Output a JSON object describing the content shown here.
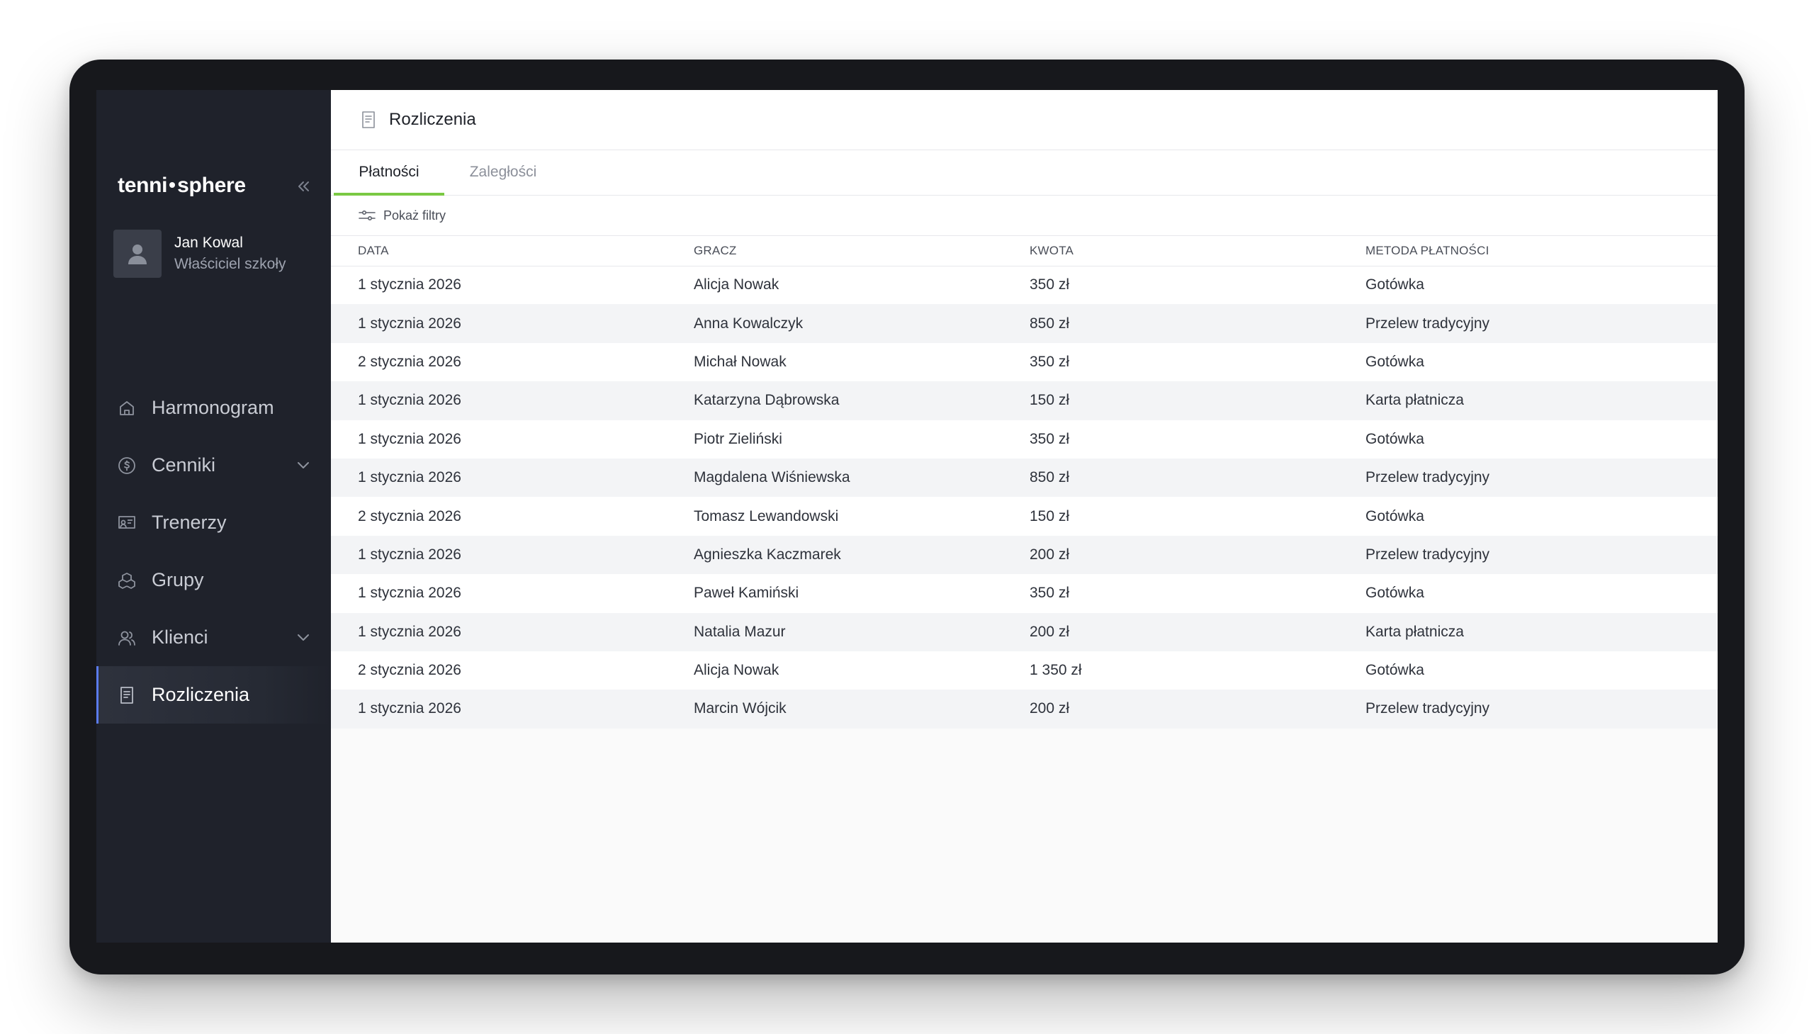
{
  "app": {
    "logo_left": "tenni",
    "logo_right": "sphere"
  },
  "user": {
    "name": "Jan Kowal",
    "role": "Właściciel szkoły"
  },
  "nav": {
    "items": [
      {
        "label": "Harmonogram",
        "icon": "home-icon"
      },
      {
        "label": "Cenniki",
        "icon": "dollar-circle-icon"
      },
      {
        "label": "Trenerzy",
        "icon": "trainer-board-icon"
      },
      {
        "label": "Grupy",
        "icon": "groups-icon"
      },
      {
        "label": "Klienci",
        "icon": "users-icon"
      },
      {
        "label": "Rozliczenia",
        "icon": "receipt-icon"
      }
    ]
  },
  "page": {
    "title": "Rozliczenia"
  },
  "tabs": {
    "payments": "Płatności",
    "arrears": "Zaległości"
  },
  "filters": {
    "label": "Pokaż filtry"
  },
  "table": {
    "headers": [
      "DATA",
      "GRACZ",
      "KWOTA",
      "METODA PŁATNOŚCI"
    ],
    "rows": [
      [
        "1 stycznia 2026",
        "Alicja Nowak",
        "350 zł",
        "Gotówka"
      ],
      [
        "1 stycznia 2026",
        "Anna Kowalczyk",
        "850 zł",
        "Przelew tradycyjny"
      ],
      [
        "2 stycznia 2026",
        "Michał Nowak",
        "350 zł",
        "Gotówka"
      ],
      [
        "1 stycznia 2026",
        "Katarzyna Dąbrowska",
        "150 zł",
        "Karta płatnicza"
      ],
      [
        "1 stycznia 2026",
        "Piotr Zieliński",
        "350 zł",
        "Gotówka"
      ],
      [
        "1 stycznia 2026",
        "Magdalena Wiśniewska",
        "850 zł",
        "Przelew tradycyjny"
      ],
      [
        "2 stycznia 2026",
        "Tomasz Lewandowski",
        "150 zł",
        "Gotówka"
      ],
      [
        "1 stycznia 2026",
        "Agnieszka Kaczmarek",
        "200 zł",
        "Przelew tradycyjny"
      ],
      [
        "1 stycznia 2026",
        "Paweł Kamiński",
        "350 zł",
        "Gotówka"
      ],
      [
        "1 stycznia 2026",
        "Natalia Mazur",
        "200 zł",
        "Karta płatnicza"
      ],
      [
        "2 stycznia 2026",
        "Alicja Nowak",
        "1 350 zł",
        "Gotówka"
      ],
      [
        "1 stycznia 2026",
        "Marcin Wójcik",
        "200 zł",
        "Przelew tradycyjny"
      ]
    ]
  },
  "colors": {
    "sidebar_bg": "#1f222b",
    "tab_accent": "#7ac943",
    "device_frame": "#17181c"
  }
}
